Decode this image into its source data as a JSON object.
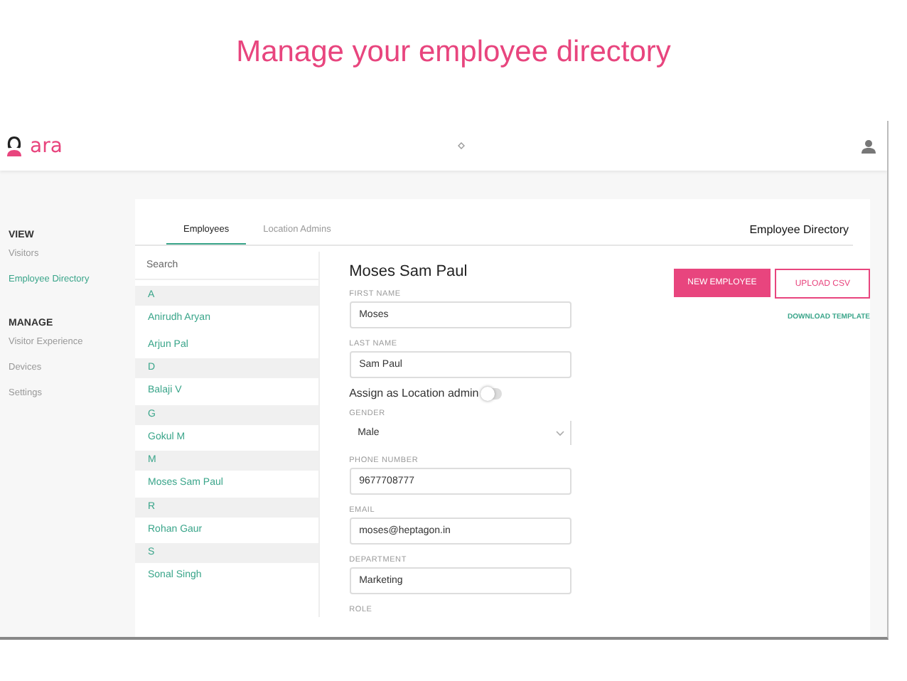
{
  "slide_title": "Manage your employee directory",
  "app": {
    "logo": "ara"
  },
  "sidebar": {
    "sections": [
      {
        "heading": "VIEW",
        "items": [
          {
            "label": "Visitors",
            "selected": false
          },
          {
            "label": "Employee Directory",
            "selected": true
          }
        ]
      },
      {
        "heading": "MANAGE",
        "items": [
          {
            "label": "Visitor Experience",
            "selected": false
          },
          {
            "label": "Devices",
            "selected": false
          },
          {
            "label": "Settings",
            "selected": false
          }
        ]
      }
    ]
  },
  "tabs": [
    {
      "label": "Employees",
      "selected": true
    },
    {
      "label": "Location Admins",
      "selected": false
    }
  ],
  "page_title": "Employee Directory",
  "search": {
    "placeholder": "Search"
  },
  "employee_list": [
    {
      "letter": "A",
      "names": [
        "Anirudh Aryan",
        "Arjun Pal"
      ]
    },
    {
      "letter": "D",
      "names": [
        "Balaji V"
      ]
    },
    {
      "letter": "G",
      "names": [
        "Gokul M"
      ]
    },
    {
      "letter": "M",
      "names": [
        "Moses Sam Paul"
      ]
    },
    {
      "letter": "R",
      "names": [
        "Rohan Gaur"
      ]
    },
    {
      "letter": "S",
      "names": [
        "Sonal Singh"
      ]
    }
  ],
  "detail": {
    "name": "Moses Sam Paul",
    "fields": [
      {
        "kind": "text",
        "label": "FIRST NAME",
        "value": "Moses"
      },
      {
        "kind": "text",
        "label": "LAST NAME",
        "value": "Sam Paul"
      },
      {
        "kind": "toggle",
        "label": "Assign as Location admin",
        "on": false
      },
      {
        "kind": "select",
        "label": "GENDER",
        "value": "Male"
      },
      {
        "kind": "text",
        "label": "PHONE NUMBER",
        "value": "9677708777"
      },
      {
        "kind": "text",
        "label": "EMAIL",
        "value": "moses@heptagon.in"
      },
      {
        "kind": "text",
        "label": "DEPARTMENT",
        "value": "Marketing"
      },
      {
        "kind": "label",
        "label": "ROLE"
      }
    ]
  },
  "actions": {
    "primary": "NEW EMPLOYEE",
    "secondary": "UPLOAD CSV",
    "link": "DOWNLOAD TEMPLATE"
  }
}
